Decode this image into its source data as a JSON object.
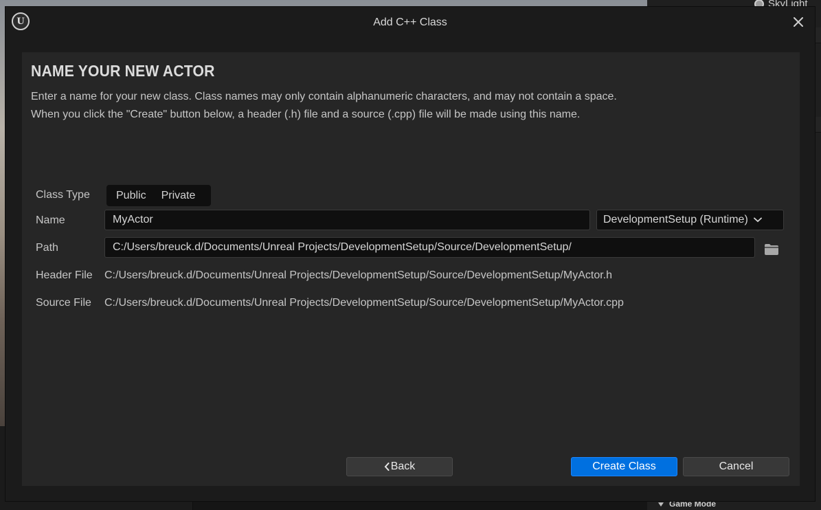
{
  "background": {
    "right_panel_item": "SkyLight",
    "right_panel_section": "Game Mode"
  },
  "dialog": {
    "title": "Add C++ Class",
    "heading": "NAME YOUR NEW ACTOR",
    "description_line1": "Enter a name for your new class. Class names may only contain alphanumeric characters, and may not contain a space.",
    "description_line2": "When you click the \"Create\" button below, a header (.h) file and a source (.cpp) file will be made using this name."
  },
  "form": {
    "class_type": {
      "label": "Class Type",
      "options": [
        "Public",
        "Private"
      ]
    },
    "name": {
      "label": "Name",
      "value": "MyActor"
    },
    "module": {
      "selected": "DevelopmentSetup (Runtime)"
    },
    "path": {
      "label": "Path",
      "value": "C:/Users/breuck.d/Documents/Unreal Projects/DevelopmentSetup/Source/DevelopmentSetup/"
    },
    "header_file": {
      "label": "Header File",
      "value": "C:/Users/breuck.d/Documents/Unreal Projects/DevelopmentSetup/Source/DevelopmentSetup/MyActor.h"
    },
    "source_file": {
      "label": "Source File",
      "value": "C:/Users/breuck.d/Documents/Unreal Projects/DevelopmentSetup/Source/DevelopmentSetup/MyActor.cpp"
    }
  },
  "buttons": {
    "back": "Back",
    "create": "Create Class",
    "cancel": "Cancel"
  },
  "colors": {
    "accent": "#0070e0",
    "window_bg": "#1b1b1b",
    "panel_bg": "#262626",
    "field_bg": "#0f0f0f"
  }
}
